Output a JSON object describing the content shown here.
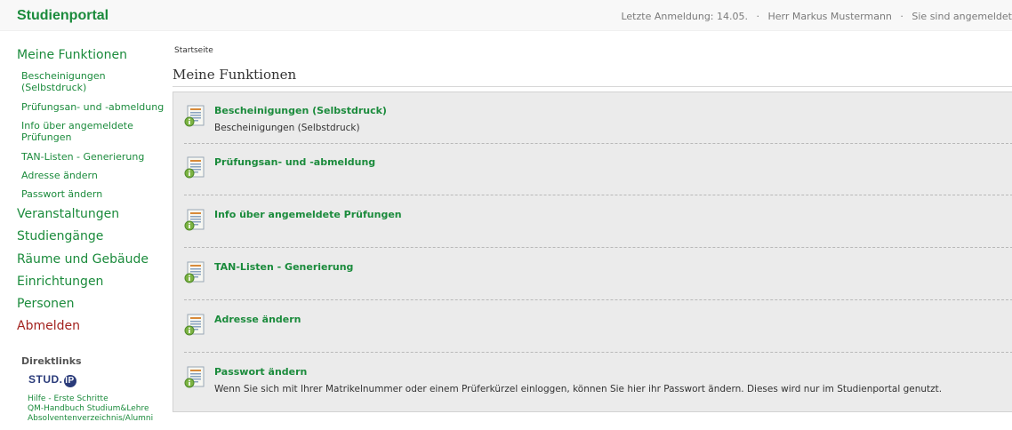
{
  "header": {
    "app_title": "Studienportal",
    "last_login_label": "Letzte Anmeldung:",
    "last_login_date": "14.05.",
    "user_name": "Herr Markus Mustermann",
    "status": "Sie sind angemeldet",
    "separator": "·"
  },
  "sidebar": {
    "section_title": "Meine Funktionen",
    "sub_items": [
      {
        "label": "Bescheinigungen"
      },
      {
        "label": "(Selbstdruck)"
      },
      {
        "label": "Prüfungsan- und -abmeldung"
      },
      {
        "label": "Info über angemeldete"
      },
      {
        "label": "Prüfungen"
      },
      {
        "label": "TAN-Listen - Generierung"
      },
      {
        "label": "Adresse ändern"
      },
      {
        "label": "Passwort ändern"
      }
    ],
    "nav": [
      {
        "label": "Veranstaltungen"
      },
      {
        "label": "Studiengänge"
      },
      {
        "label": "Räume und Gebäude"
      },
      {
        "label": "Einrichtungen"
      },
      {
        "label": "Personen"
      },
      {
        "label": "Abmelden"
      }
    ],
    "direktlinks_title": "Direktlinks",
    "logo_text": "STUD.",
    "logo_circle": "IP",
    "direktlinks": [
      {
        "label": "Hilfe - Erste Schritte"
      },
      {
        "label": "QM-Handbuch Studium&Lehre"
      },
      {
        "label": "Absolventenverzeichnis/Alumni"
      }
    ]
  },
  "main": {
    "breadcrumb": "Startseite",
    "title": "Meine Funktionen",
    "entries": [
      {
        "title": "Bescheinigungen (Selbstdruck)",
        "description": "Bescheinigungen (Selbstdruck)"
      },
      {
        "title": "Prüfungsan- und -abmeldung",
        "description": ""
      },
      {
        "title": "Info über angemeldete Prüfungen",
        "description": ""
      },
      {
        "title": "TAN-Listen - Generierung",
        "description": ""
      },
      {
        "title": "Adresse ändern",
        "description": ""
      },
      {
        "title": "Passwort ändern",
        "description": "Wenn Sie sich mit Ihrer Matrikelnummer oder einem Prüferkürzel einloggen, können Sie hier ihr Passwort ändern. Dieses wird nur im Studienportal genutzt."
      }
    ],
    "icon": "document-info-icon"
  },
  "colors": {
    "accent_green": "#1b8b3c",
    "logout_red": "#a3231f",
    "panel_bg": "#ebebeb"
  }
}
